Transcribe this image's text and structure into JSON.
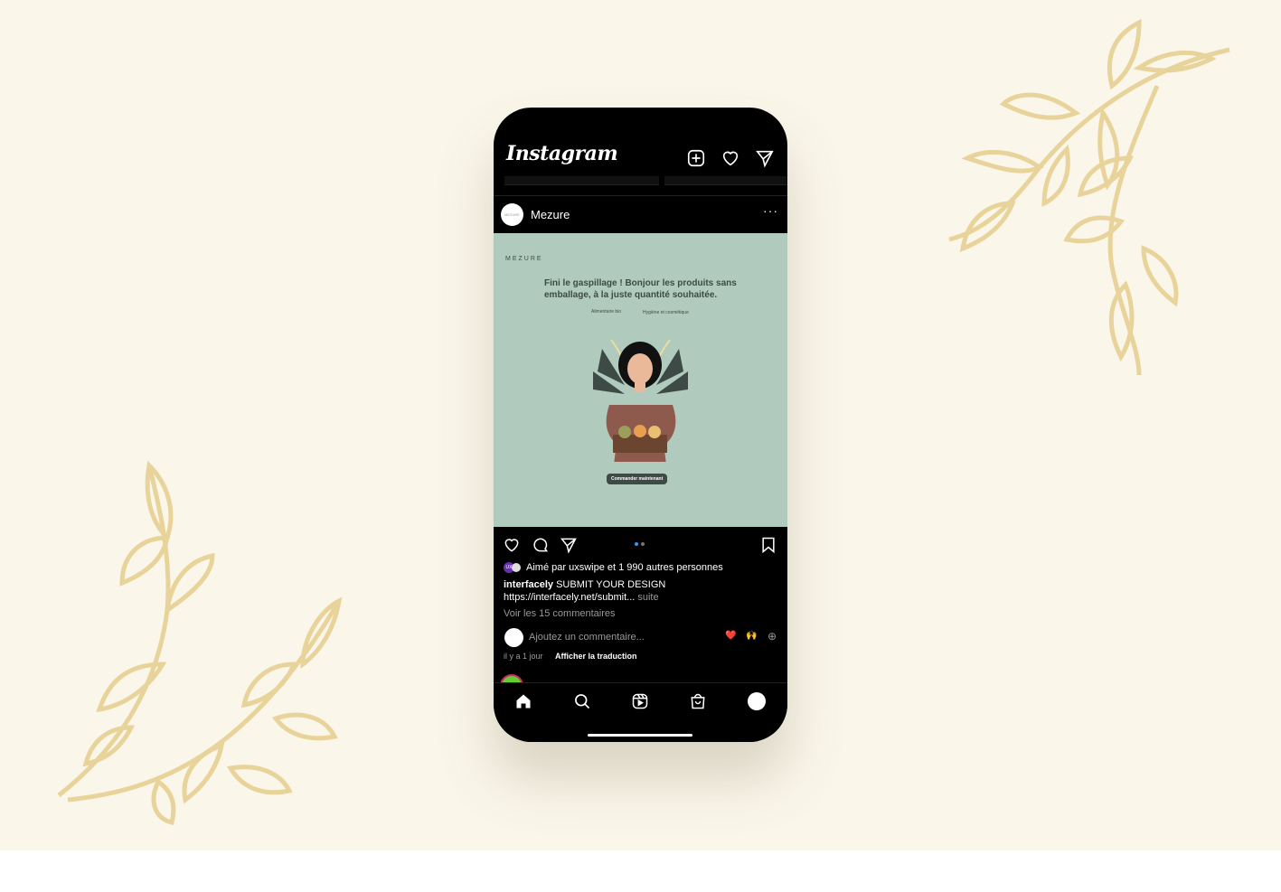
{
  "header": {
    "logo": "Instagram",
    "icons": [
      "new-post-icon",
      "heart-icon",
      "direct-icon"
    ]
  },
  "post": {
    "username": "Mezure",
    "avatar_text": "MEZURE",
    "more": "···",
    "image": {
      "brand": "MEZURE",
      "headline": "Fini le gaspillage ! Bonjour les produits sans emballage, à la juste quantité souhaitée.",
      "categories": [
        "Alimentaire bio",
        "Hygiène et cosmétique"
      ],
      "cta": "Commander maintenant"
    },
    "carousel": {
      "count": 2,
      "active": 0
    },
    "likes": {
      "prefix": "Aimé par ",
      "user": "uxswipe",
      "middle": " et ",
      "count": "1 990 autres personnes"
    },
    "caption": {
      "user": "interfacely",
      "text": " SUBMIT YOUR DESIGN",
      "link": "https://interfacely.net/submit...",
      "more": " suite"
    },
    "view_comments": "Voir les 15 commentaires",
    "comment_placeholder": "Ajoutez un commentaire...",
    "reactions": [
      "❤️",
      "🙌"
    ],
    "time": "il y a 1 jour",
    "translate": "Afficher la traduction"
  },
  "colors": {
    "background": "#faf6ea",
    "leaf": "#e8d49a",
    "image_bg": "#b0cbbe",
    "accent": "#3897f0"
  }
}
